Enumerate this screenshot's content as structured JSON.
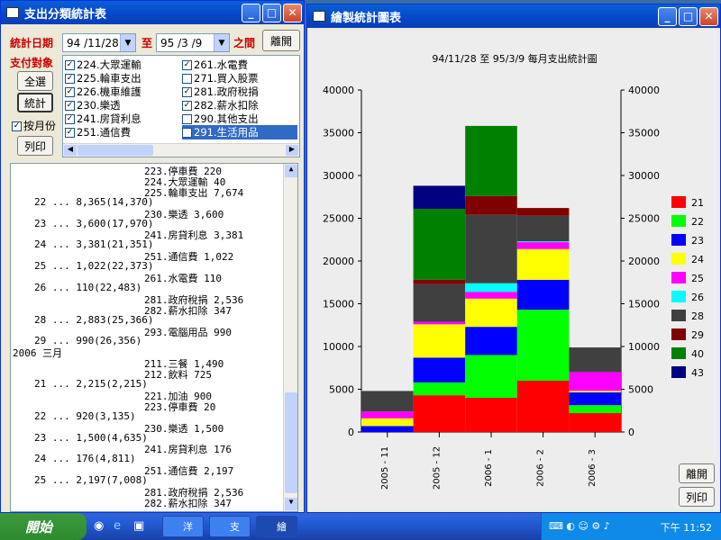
{
  "left_window": {
    "title": "支出分類統計表",
    "date_label": "統計日期",
    "date_from": "94 /11/28",
    "date_to_label": "至",
    "date_to": "95 /3 /9",
    "date_suffix": "之間",
    "leave_button": "離開",
    "pay_label": "支付對象",
    "select_all_button": "全選",
    "stats_button": "統計",
    "monthly_label": "按月份",
    "print_button": "列印",
    "categories_col1": [
      {
        "label": "224.大眾運輸",
        "checked": true
      },
      {
        "label": "225.輪車支出",
        "checked": true
      },
      {
        "label": "226.機車維護",
        "checked": true
      },
      {
        "label": "230.樂透",
        "checked": true
      },
      {
        "label": "241.房貸利息",
        "checked": true
      },
      {
        "label": "251.通信費",
        "checked": true
      }
    ],
    "categories_col2": [
      {
        "label": "261.水電費",
        "checked": true
      },
      {
        "label": "271.買入股票",
        "checked": false
      },
      {
        "label": "281.政府稅捐",
        "checked": true
      },
      {
        "label": "282.薪水扣除",
        "checked": true
      },
      {
        "label": "290.其他支出",
        "checked": false
      },
      {
        "label": "291.生活用品",
        "checked": false
      }
    ],
    "report_lines": [
      {
        "indent": "right",
        "text": "223.停車費 220"
      },
      {
        "indent": "right",
        "text": "224.大眾運輸 40"
      },
      {
        "indent": "right",
        "text": "225.輪車支出 7,674"
      },
      {
        "indent": "left",
        "text": "22 ... 8,365(14,370)"
      },
      {
        "indent": "right",
        "text": "230.樂透 3,600"
      },
      {
        "indent": "left",
        "text": "23 ... 3,600(17,970)"
      },
      {
        "indent": "right",
        "text": "241.房貸利息 3,381"
      },
      {
        "indent": "left",
        "text": "24 ... 3,381(21,351)"
      },
      {
        "indent": "right",
        "text": "251.通信費 1,022"
      },
      {
        "indent": "left",
        "text": "25 ... 1,022(22,373)"
      },
      {
        "indent": "right",
        "text": "261.水電費 110"
      },
      {
        "indent": "left",
        "text": "26 ... 110(22,483)"
      },
      {
        "indent": "right",
        "text": "281.政府稅捐 2,536"
      },
      {
        "indent": "right",
        "text": "282.薪水扣除 347"
      },
      {
        "indent": "left",
        "text": "28 ... 2,883(25,366)"
      },
      {
        "indent": "right",
        "text": "293.電腦用品 990"
      },
      {
        "indent": "left",
        "text": "29 ... 990(26,356)"
      },
      {
        "indent": "head",
        "text": "2006 三月"
      },
      {
        "indent": "right",
        "text": "211.三餐 1,490"
      },
      {
        "indent": "right",
        "text": "212.飲料 725"
      },
      {
        "indent": "left",
        "text": "21 ... 2,215(2,215)"
      },
      {
        "indent": "right",
        "text": "221.加油 900"
      },
      {
        "indent": "right",
        "text": "223.停車費 20"
      },
      {
        "indent": "left",
        "text": "22 ... 920(3,135)"
      },
      {
        "indent": "right",
        "text": "230.樂透 1,500"
      },
      {
        "indent": "left",
        "text": "23 ... 1,500(4,635)"
      },
      {
        "indent": "right",
        "text": "241.房貸利息 176"
      },
      {
        "indent": "left",
        "text": "24 ... 176(4,811)"
      },
      {
        "indent": "right",
        "text": "251.通信費 2,197"
      },
      {
        "indent": "left",
        "text": "25 ... 2,197(7,008)"
      },
      {
        "indent": "right",
        "text": "281.政府稅捐 2,536"
      },
      {
        "indent": "right",
        "text": "282.薪水扣除 347"
      }
    ]
  },
  "right_window": {
    "title": "繪製統計圖表",
    "leave_button": "離開",
    "print_button": "列印"
  },
  "chart_data": {
    "type": "bar",
    "stacked": true,
    "title": "94/11/28 至 95/3/9 每月支出統計圖",
    "categories": [
      "2005 - 11",
      "2005 - 12",
      "2006 - 1",
      "2006 - 2",
      "2006 - 3"
    ],
    "ylim": [
      0,
      40000
    ],
    "yticks": [
      0,
      5000,
      10000,
      15000,
      20000,
      25000,
      30000,
      35000,
      40000
    ],
    "series": [
      {
        "name": "21",
        "color": "#ff0000",
        "values": [
          0,
          4300,
          4000,
          6000,
          2215
        ]
      },
      {
        "name": "22",
        "color": "#00ff00",
        "values": [
          0,
          1500,
          5000,
          8300,
          920
        ]
      },
      {
        "name": "23",
        "color": "#0000ff",
        "values": [
          700,
          2900,
          3300,
          3500,
          1500
        ]
      },
      {
        "name": "24",
        "color": "#ffff00",
        "values": [
          900,
          3900,
          3300,
          3600,
          176
        ]
      },
      {
        "name": "25",
        "color": "#ff00ff",
        "values": [
          800,
          300,
          800,
          800,
          2197
        ]
      },
      {
        "name": "26",
        "color": "#00ffff",
        "values": [
          0,
          0,
          1000,
          100,
          0
        ]
      },
      {
        "name": "28",
        "color": "#404040",
        "values": [
          2400,
          4400,
          8000,
          3000,
          2883
        ]
      },
      {
        "name": "29",
        "color": "#800000",
        "values": [
          0,
          500,
          2200,
          900,
          0
        ]
      },
      {
        "name": "40",
        "color": "#008000",
        "values": [
          0,
          8300,
          8200,
          0,
          0
        ]
      },
      {
        "name": "43",
        "color": "#000080",
        "values": [
          0,
          2700,
          0,
          0,
          0
        ]
      }
    ]
  },
  "taskbar": {
    "start_label": "開始",
    "items": [
      "洋",
      "支",
      "繪"
    ],
    "clock": "下午 11:52"
  }
}
